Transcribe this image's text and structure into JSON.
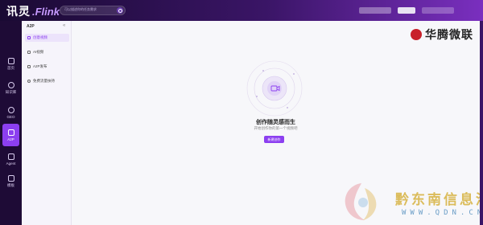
{
  "app": {
    "logo_cn": "讯灵",
    "logo_en": ".Flink",
    "search_placeholder": "可以描述你的任务需求"
  },
  "rail": {
    "items": [
      {
        "label": "首页",
        "icon": "home-icon"
      },
      {
        "label": "知识库",
        "icon": "knowledge-icon"
      },
      {
        "label": "GEO",
        "icon": "geo-icon"
      },
      {
        "label": "A2P",
        "icon": "a2p-icon",
        "active": true
      },
      {
        "label": "Agent",
        "icon": "agent-icon"
      },
      {
        "label": "模板",
        "icon": "template-icon"
      }
    ]
  },
  "sidebar": {
    "title": "A2P",
    "collapse": "«",
    "items": [
      {
        "label": "创意视频",
        "active": true
      },
      {
        "label": "AI视频"
      },
      {
        "label": "A2P发布"
      },
      {
        "label": "免费流量扶持"
      }
    ]
  },
  "main": {
    "brand": "华腾微联",
    "empty_title": "创作随灵感而生",
    "empty_subtitle": "开始创作你的第一个视频吧",
    "create_button": "新建创作"
  },
  "watermark": {
    "text": "黔东南信息港",
    "url": "WWW.QDN.CN"
  },
  "colors": {
    "accent": "#8c3ff0",
    "topbar_dark": "#1a0a33",
    "rail_bg": "#1e0b36",
    "brand_red": "#c8202a"
  }
}
